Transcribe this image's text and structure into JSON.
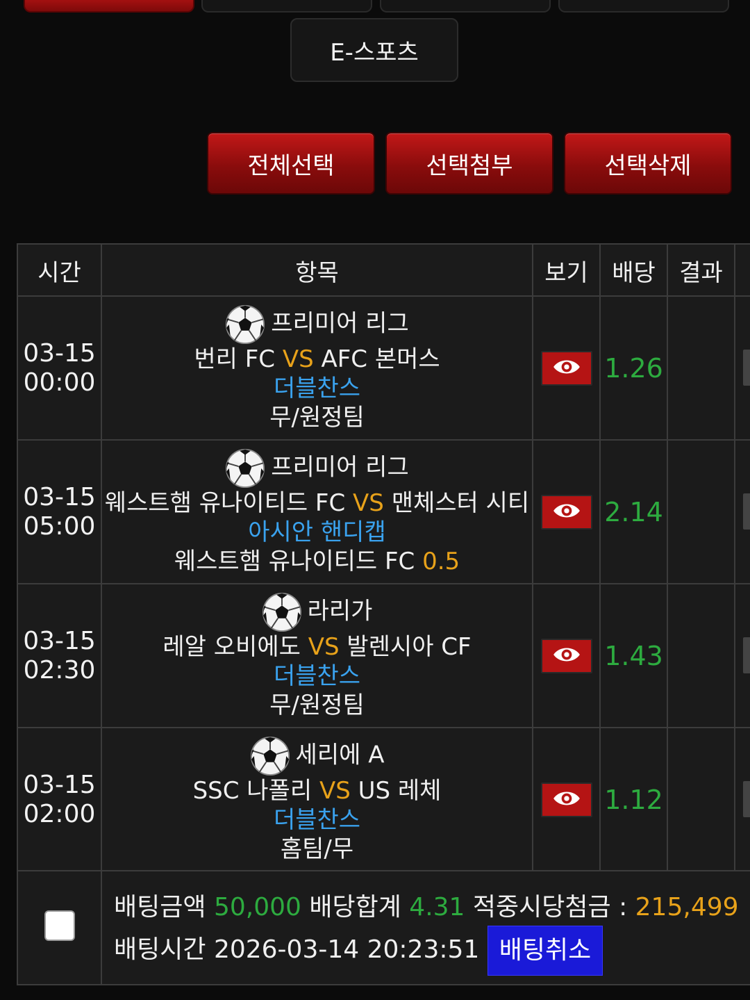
{
  "top_tabs": [
    "",
    "",
    "",
    ""
  ],
  "esports_label": "E-스포츠",
  "actions": {
    "select_all": "전체선택",
    "attach_selected": "선택첨부",
    "delete_selected": "선택삭제"
  },
  "table": {
    "headers": {
      "time": "시간",
      "item": "항목",
      "view": "보기",
      "odds": "배당",
      "result": "결과"
    },
    "rows": [
      {
        "date": "03-15",
        "clock": "00:00",
        "league": "프리미어 리그",
        "home": "번리 FC",
        "vs": "VS",
        "away": "AFC 본머스",
        "market": "더블찬스",
        "pick": "무/원정팀",
        "pick_value": "",
        "odds": "1.26",
        "result": ""
      },
      {
        "date": "03-15",
        "clock": "05:00",
        "league": "프리미어 리그",
        "home": "웨스트햄 유나이티드 FC",
        "vs": "VS",
        "away": "맨체스터 시티",
        "market": "아시안 핸디캡",
        "pick": "웨스트햄 유나이티드 FC",
        "pick_value": "0.5",
        "odds": "2.14",
        "result": ""
      },
      {
        "date": "03-15",
        "clock": "02:30",
        "league": "라리가",
        "home": "레알 오비에도",
        "vs": "VS",
        "away": "발렌시아 CF",
        "market": "더블찬스",
        "pick": "무/원정팀",
        "pick_value": "",
        "odds": "1.43",
        "result": ""
      },
      {
        "date": "03-15",
        "clock": "02:00",
        "league": "세리에 A",
        "home": "SSC 나폴리",
        "vs": "VS",
        "away": "US 레체",
        "market": "더블찬스",
        "pick": "홈팀/무",
        "pick_value": "",
        "odds": "1.12",
        "result": ""
      }
    ]
  },
  "summary": {
    "bet_amount_label": "배팅금액",
    "bet_amount": "50,000",
    "total_odds_label": "배당합계",
    "total_odds": "4.31",
    "payout_label": "적중시당첨금 :",
    "payout": "215,499",
    "bet_time_label": "배팅시간",
    "bet_time": "2026-03-14 20:23:51",
    "cancel_label": "배팅취소"
  },
  "colors": {
    "accent_red": "#b51414",
    "vs_orange": "#e8a21a",
    "market_blue": "#3aa2ee",
    "odds_green": "#2dab3f",
    "cancel_blue": "#1a1ad8"
  }
}
